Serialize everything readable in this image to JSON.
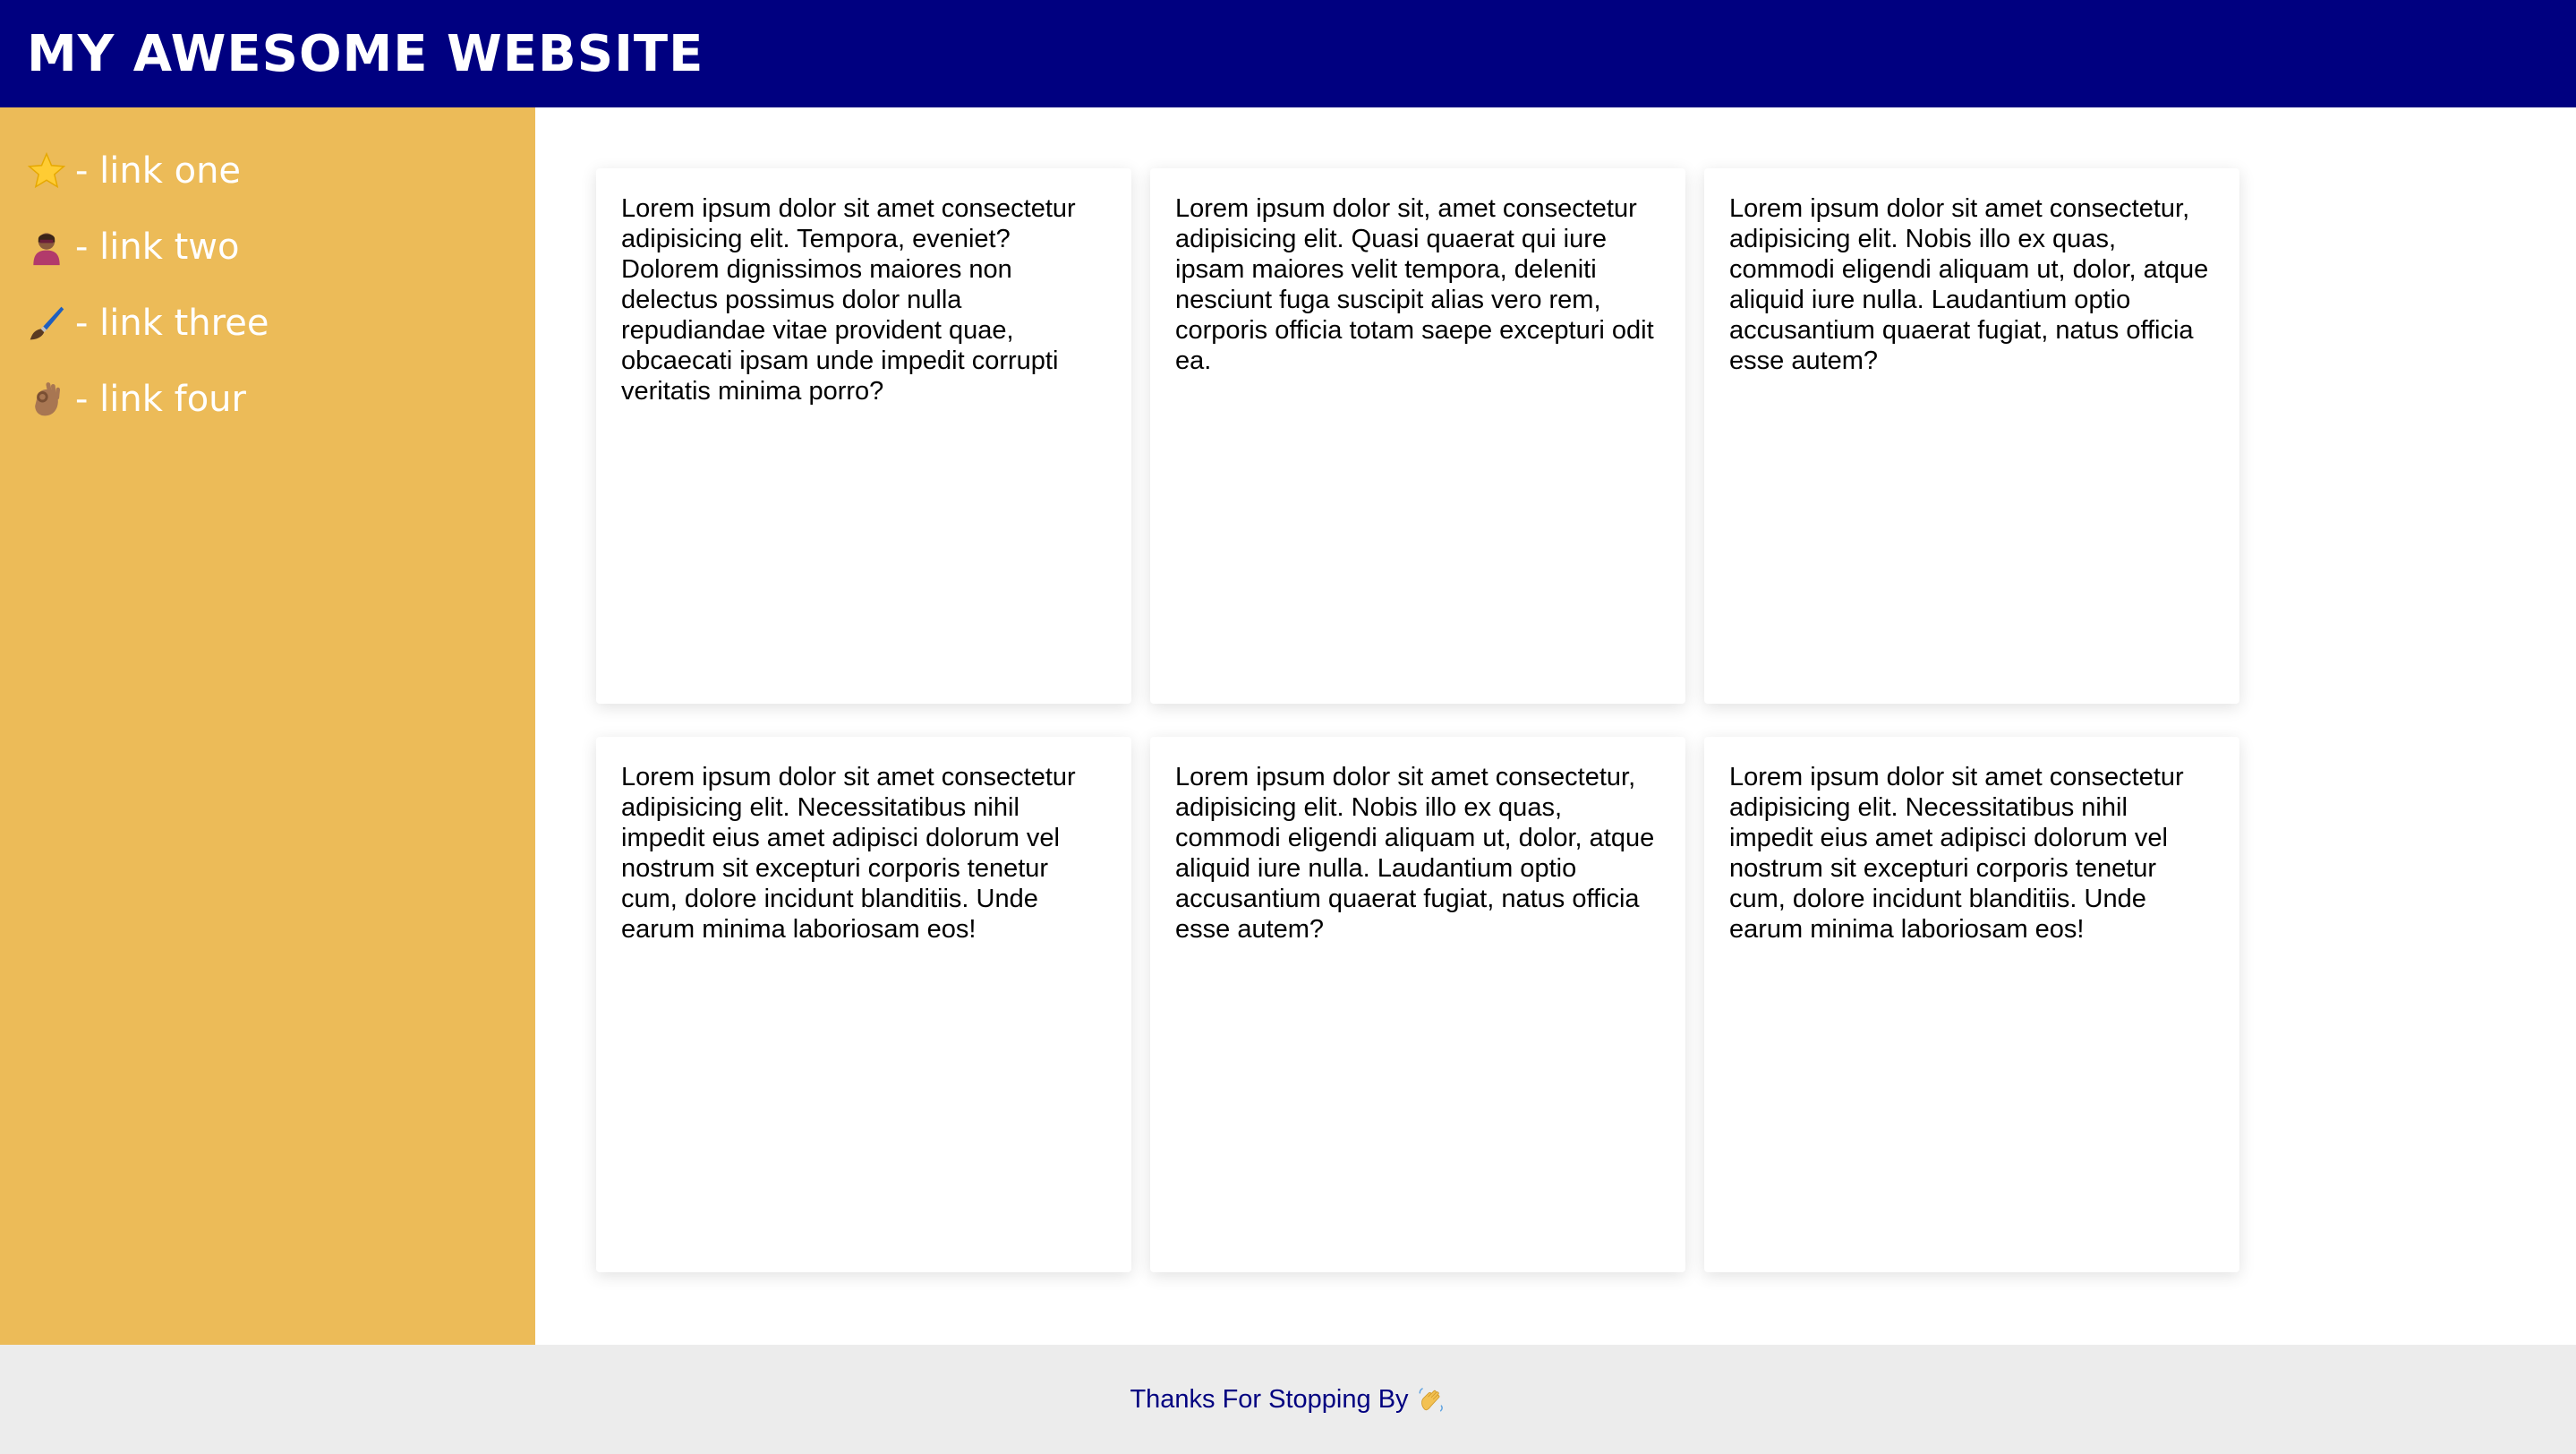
{
  "header": {
    "title": "MY AWESOME WEBSITE"
  },
  "sidebar": {
    "items": [
      {
        "icon": "star-icon",
        "label": "- link one"
      },
      {
        "icon": "superhero-icon",
        "label": "- link two"
      },
      {
        "icon": "paintbrush-icon",
        "label": "- link three"
      },
      {
        "icon": "ok-hand-icon",
        "label": "- link four"
      }
    ]
  },
  "cards": [
    {
      "text": "Lorem ipsum dolor sit amet consectetur adipisicing elit. Tempora, eveniet? Dolorem dignissimos maiores non delectus possimus dolor nulla repudiandae vitae provident quae, obcaecati ipsam unde impedit corrupti veritatis minima porro?"
    },
    {
      "text": "Lorem ipsum dolor sit, amet consectetur adipisicing elit. Quasi quaerat qui iure ipsam maiores velit tempora, deleniti nesciunt fuga suscipit alias vero rem, corporis officia totam saepe excepturi odit ea."
    },
    {
      "text": "Lorem ipsum dolor sit amet consectetur, adipisicing elit. Nobis illo ex quas, commodi eligendi aliquam ut, dolor, atque aliquid iure nulla. Laudantium optio accusantium quaerat fugiat, natus officia esse autem?"
    },
    {
      "text": "Lorem ipsum dolor sit amet consectetur adipisicing elit. Necessitatibus nihil impedit eius amet adipisci dolorum vel nostrum sit excepturi corporis tenetur cum, dolore incidunt blanditiis. Unde earum minima laboriosam eos!"
    },
    {
      "text": "Lorem ipsum dolor sit amet consectetur, adipisicing elit. Nobis illo ex quas, commodi eligendi aliquam ut, dolor, atque aliquid iure nulla. Laudantium optio accusantium quaerat fugiat, natus officia esse autem?"
    },
    {
      "text": "Lorem ipsum dolor sit amet consectetur adipisicing elit. Necessitatibus nihil impedit eius amet adipisci dolorum vel nostrum sit excepturi corporis tenetur cum, dolore incidunt blanditiis. Unde earum minima laboriosam eos!"
    }
  ],
  "footer": {
    "text": "Thanks For Stopping By",
    "icon": "waving-hand-icon"
  },
  "colors": {
    "header_bg": "#000080",
    "sidebar_bg": "#ecbb58",
    "footer_bg": "#ececec",
    "footer_text": "#000080"
  }
}
